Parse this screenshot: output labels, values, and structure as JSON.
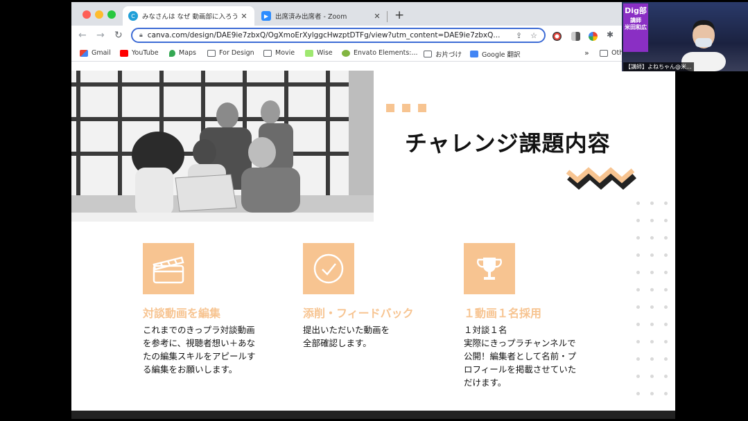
{
  "browser": {
    "tabs": [
      {
        "title": "みなさんは なぜ 動画部に入ろうと",
        "active": true
      },
      {
        "title": "出席済み出席者 - Zoom",
        "active": false
      }
    ],
    "url": "canva.com/design/DAE9ie7zbxQ/OgXmoErXylggcHwzptDTFg/view?utm_content=DAE9ie7zbxQ...",
    "bookmarks": [
      {
        "label": "Gmail",
        "icon": "gmail-icon"
      },
      {
        "label": "YouTube",
        "icon": "youtube-icon"
      },
      {
        "label": "Maps",
        "icon": "maps-icon"
      },
      {
        "label": "For Design",
        "icon": "folder-icon"
      },
      {
        "label": "Movie",
        "icon": "folder-icon"
      },
      {
        "label": "Wise",
        "icon": "wise-icon"
      },
      {
        "label": "Envato Elements:...",
        "icon": "envato-icon"
      },
      {
        "label": "お片づけ",
        "icon": "folder-icon"
      },
      {
        "label": "Google 翻訳",
        "icon": "google-translate-icon"
      },
      {
        "label": "Oth",
        "icon": "folder-icon"
      }
    ],
    "more_label": "»"
  },
  "slide": {
    "title": "チャレンジ課題内容",
    "accent_color": "#f7c491",
    "cards": [
      {
        "icon": "clapperboard-icon",
        "heading": "対談動画を編集",
        "lines": [
          "これまでのきっプラ対談動画",
          "を参考に、視聴者想い＋あな",
          "たの編集スキルをアピールす",
          "る編集をお願いします。"
        ]
      },
      {
        "icon": "checkmark-circle-icon",
        "heading": "添削・フィードバック",
        "lines": [
          "提出いただいた動画を",
          "全部確認します。"
        ]
      },
      {
        "icon": "trophy-icon",
        "heading": "１動画１名採用",
        "lines": [
          "１対談１名",
          "実際にきっプラチャンネルで",
          "公開！編集者として名前・プ",
          "ロフィールを掲載させていた",
          "だけます。"
        ]
      }
    ]
  },
  "zoom": {
    "badge_top": "Dig部",
    "badge_role": "講師",
    "badge_name": "米田和広",
    "participant_name": "【講師】よねちゃん@米..."
  }
}
